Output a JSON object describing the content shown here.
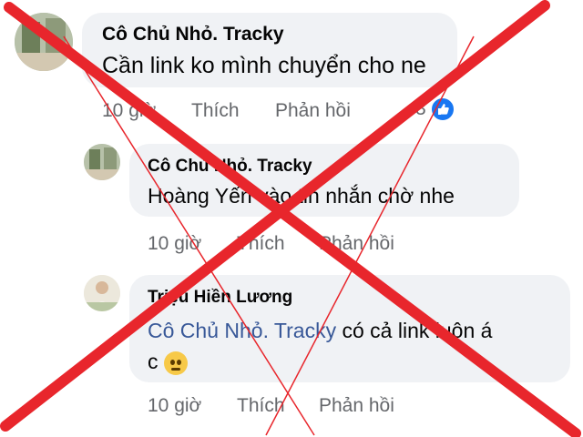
{
  "comments": [
    {
      "author": "Cô Chủ Nhỏ. Tracky",
      "text": "Cần link ko mình chuyển cho ne",
      "time": "10 giờ",
      "like": "Thích",
      "reply": "Phản hồi",
      "reactions": "3"
    },
    {
      "author": "Cô Chủ Nhỏ. Tracky",
      "text": "Hoàng Yến vào tin nhắn  chờ nhe",
      "time": "10 giờ",
      "like": "Thích",
      "reply": "Phản hồi"
    },
    {
      "author": "Triệu Hiền Lương",
      "mention": "Cô Chủ Nhỏ. Tracky",
      "text_after": " có cả link luôn á",
      "text_line2": "c",
      "time": "10 giờ",
      "like": "Thích",
      "reply": "Phản hồi"
    }
  ],
  "colors": {
    "bubble": "#f0f2f5",
    "meta": "#65676b",
    "mention": "#385898",
    "cross": "#e8262c",
    "like_badge": "#1877f2"
  },
  "icons": {
    "reaction": "like-thumb-icon",
    "emoji": "worried-face-emoji"
  }
}
